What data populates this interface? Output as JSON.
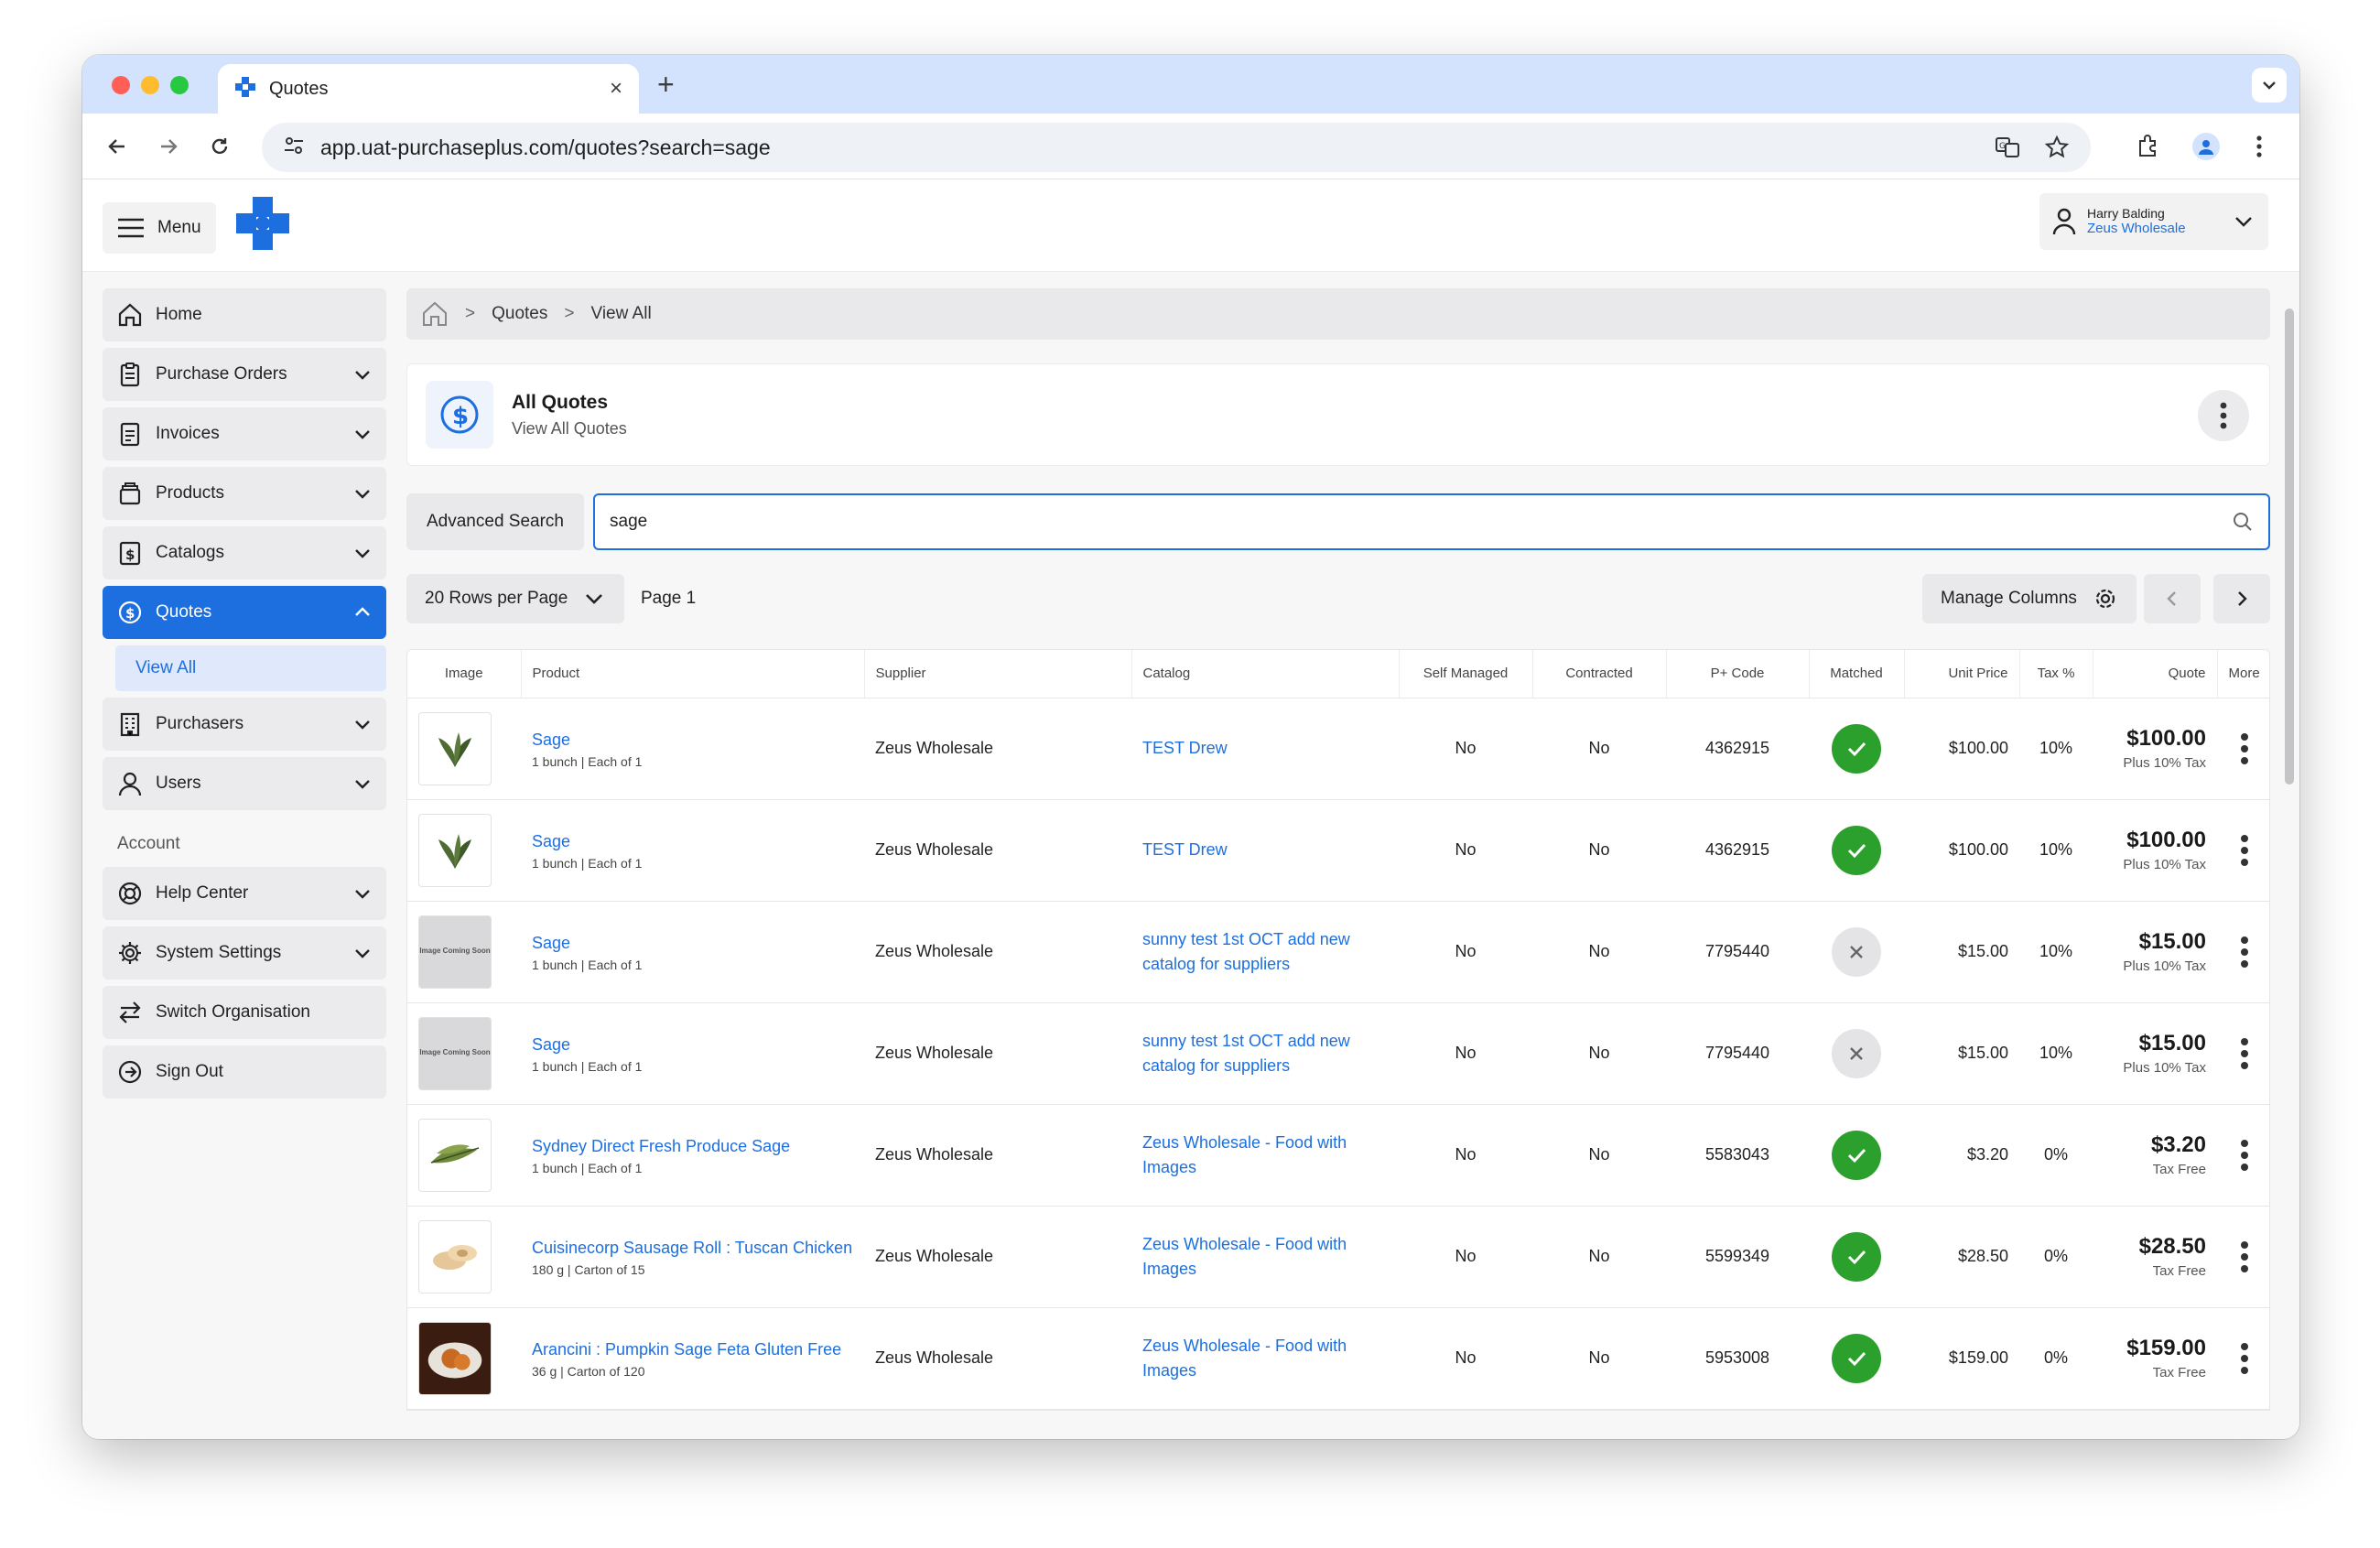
{
  "browser": {
    "tab_title": "Quotes",
    "url": "app.uat-purchaseplus.com/quotes?search=sage"
  },
  "topbar": {
    "menu_label": "Menu",
    "user_name": "Harry Balding",
    "user_org": "Zeus Wholesale"
  },
  "sidebar": {
    "items": [
      {
        "label": "Home",
        "icon": "home-icon"
      },
      {
        "label": "Purchase Orders",
        "icon": "clipboard-icon"
      },
      {
        "label": "Invoices",
        "icon": "document-icon"
      },
      {
        "label": "Products",
        "icon": "products-icon"
      },
      {
        "label": "Catalogs",
        "icon": "catalog-icon"
      },
      {
        "label": "Quotes",
        "icon": "dollar-icon"
      },
      {
        "label": "Purchasers",
        "icon": "building-icon"
      },
      {
        "label": "Users",
        "icon": "user-icon"
      }
    ],
    "quotes_sub": "View All",
    "account_label": "Account",
    "account_items": [
      {
        "label": "Help Center",
        "icon": "lifebuoy-icon"
      },
      {
        "label": "System Settings",
        "icon": "gear-icon"
      },
      {
        "label": "Switch Organisation",
        "icon": "switch-icon"
      },
      {
        "label": "Sign Out",
        "icon": "sign-out-icon"
      }
    ]
  },
  "breadcrumb": {
    "items": [
      "Quotes",
      "View All"
    ]
  },
  "header": {
    "title": "All Quotes",
    "subtitle": "View All Quotes"
  },
  "search": {
    "advanced_label": "Advanced Search",
    "value": "sage"
  },
  "pager": {
    "rows_label": "20 Rows per Page",
    "page_label": "Page 1",
    "manage_label": "Manage Columns"
  },
  "table": {
    "columns": [
      "Image",
      "Product",
      "Supplier",
      "Catalog",
      "Self Managed",
      "Contracted",
      "P+ Code",
      "Matched",
      "Unit Price",
      "Tax %",
      "Quote",
      "More"
    ],
    "rows": [
      {
        "image": "sage",
        "product": "Sage",
        "sub": "1 bunch | Each of 1",
        "supplier": "Zeus Wholesale",
        "catalog": "TEST Drew",
        "self_managed": "No",
        "contracted": "No",
        "code": "4362915",
        "matched": true,
        "unit_price": "$100.00",
        "tax": "10%",
        "quote": "$100.00",
        "quote_tax": "Plus 10% Tax"
      },
      {
        "image": "sage",
        "product": "Sage",
        "sub": "1 bunch | Each of 1",
        "supplier": "Zeus Wholesale",
        "catalog": "TEST Drew",
        "self_managed": "No",
        "contracted": "No",
        "code": "4362915",
        "matched": true,
        "unit_price": "$100.00",
        "tax": "10%",
        "quote": "$100.00",
        "quote_tax": "Plus 10% Tax"
      },
      {
        "image": "soon",
        "product": "Sage",
        "sub": "1 bunch | Each of 1",
        "supplier": "Zeus Wholesale",
        "catalog": "sunny test 1st OCT add new catalog for suppliers",
        "self_managed": "No",
        "contracted": "No",
        "code": "7795440",
        "matched": false,
        "unit_price": "$15.00",
        "tax": "10%",
        "quote": "$15.00",
        "quote_tax": "Plus 10% Tax"
      },
      {
        "image": "soon",
        "product": "Sage",
        "sub": "1 bunch | Each of 1",
        "supplier": "Zeus Wholesale",
        "catalog": "sunny test 1st OCT add new catalog for suppliers",
        "self_managed": "No",
        "contracted": "No",
        "code": "7795440",
        "matched": false,
        "unit_price": "$15.00",
        "tax": "10%",
        "quote": "$15.00",
        "quote_tax": "Plus 10% Tax"
      },
      {
        "image": "leaf",
        "product": "Sydney Direct Fresh Produce Sage",
        "sub": "1 bunch | Each of 1",
        "supplier": "Zeus Wholesale",
        "catalog": "Zeus Wholesale - Food with Images",
        "self_managed": "No",
        "contracted": "No",
        "code": "5583043",
        "matched": true,
        "unit_price": "$3.20",
        "tax": "0%",
        "quote": "$3.20",
        "quote_tax": "Tax Free"
      },
      {
        "image": "roll",
        "product": "Cuisinecorp Sausage Roll : Tuscan Chicken",
        "sub": "180 g | Carton of 15",
        "supplier": "Zeus Wholesale",
        "catalog": "Zeus Wholesale - Food with Images",
        "self_managed": "No",
        "contracted": "No",
        "code": "5599349",
        "matched": true,
        "unit_price": "$28.50",
        "tax": "0%",
        "quote": "$28.50",
        "quote_tax": "Tax Free"
      },
      {
        "image": "arancini",
        "product": "Arancini : Pumpkin Sage Feta Gluten Free",
        "sub": "36 g | Carton of 120",
        "supplier": "Zeus Wholesale",
        "catalog": "Zeus Wholesale - Food with Images",
        "self_managed": "No",
        "contracted": "No",
        "code": "5953008",
        "matched": true,
        "unit_price": "$159.00",
        "tax": "0%",
        "quote": "$159.00",
        "quote_tax": "Tax Free"
      }
    ],
    "image_placeholder": "Image Coming Soon"
  },
  "colors": {
    "accent": "#1d6fe0",
    "matched_green": "#2ca02c",
    "tabstrip": "#d3e3fd"
  }
}
